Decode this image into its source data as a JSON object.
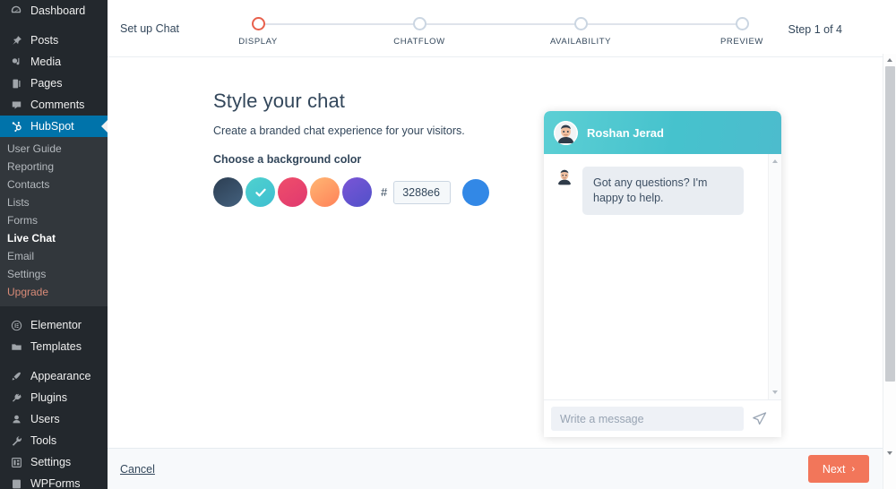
{
  "sidebar": {
    "primary": [
      {
        "label": "Dashboard",
        "icon": "dashboard-icon"
      },
      {
        "label": "Posts",
        "icon": "pin-icon"
      },
      {
        "label": "Media",
        "icon": "media-icon"
      },
      {
        "label": "Pages",
        "icon": "page-icon"
      },
      {
        "label": "Comments",
        "icon": "comment-icon"
      },
      {
        "label": "HubSpot",
        "icon": "hubspot-icon",
        "active": true
      }
    ],
    "hubspot_submenu": [
      {
        "label": "User Guide"
      },
      {
        "label": "Reporting"
      },
      {
        "label": "Contacts"
      },
      {
        "label": "Lists"
      },
      {
        "label": "Forms"
      },
      {
        "label": "Live Chat",
        "current": true
      },
      {
        "label": "Email"
      },
      {
        "label": "Settings"
      },
      {
        "label": "Upgrade",
        "upgrade": true
      }
    ],
    "secondary": [
      {
        "label": "Elementor",
        "icon": "elementor-icon"
      },
      {
        "label": "Templates",
        "icon": "folder-icon"
      }
    ],
    "tertiary": [
      {
        "label": "Appearance",
        "icon": "brush-icon"
      },
      {
        "label": "Plugins",
        "icon": "plug-icon"
      },
      {
        "label": "Users",
        "icon": "user-icon"
      },
      {
        "label": "Tools",
        "icon": "wrench-icon"
      },
      {
        "label": "Settings",
        "icon": "settings-icon"
      },
      {
        "label": "WPForms",
        "icon": "wpforms-icon"
      }
    ]
  },
  "header": {
    "setup_label": "Set up Chat",
    "step_count": "Step 1 of 4",
    "steps": [
      {
        "label": "DISPLAY",
        "active": true
      },
      {
        "label": "CHATFLOW",
        "active": false
      },
      {
        "label": "AVAILABILITY",
        "active": false
      },
      {
        "label": "PREVIEW",
        "active": false
      }
    ]
  },
  "content": {
    "title": "Style your chat",
    "subtitle": "Create a branded chat experience for your visitors.",
    "color_field_label": "Choose a background color",
    "hash_symbol": "#",
    "hex_value": "3288e6",
    "hex_placeholder": "3288e6",
    "preview_color": "#3288e6",
    "swatches": [
      {
        "name": "slate",
        "from": "#2c3e52",
        "to": "#44617e",
        "selected": false
      },
      {
        "name": "teal",
        "from": "#4fd1cf",
        "to": "#3fbfd0",
        "selected": true
      },
      {
        "name": "pink",
        "from": "#ef4e6b",
        "to": "#e0396f",
        "selected": false
      },
      {
        "name": "orange",
        "from": "#ffb673",
        "to": "#ff8259",
        "selected": false
      },
      {
        "name": "purple",
        "from": "#7a55d6",
        "to": "#5151c9",
        "selected": false
      }
    ]
  },
  "chat_preview": {
    "agent_name": "Roshan Jerad",
    "header_gradient_from": "#5ccfd4",
    "header_gradient_to": "#4cbccd",
    "messages": [
      {
        "from": "agent",
        "text": "Got any questions? I'm happy to help."
      }
    ],
    "input_placeholder": "Write a message",
    "send_icon": "send-icon"
  },
  "footer": {
    "cancel_label": "Cancel",
    "next_label": "Next",
    "next_chevron": "›",
    "next_color": "#f2765a"
  }
}
